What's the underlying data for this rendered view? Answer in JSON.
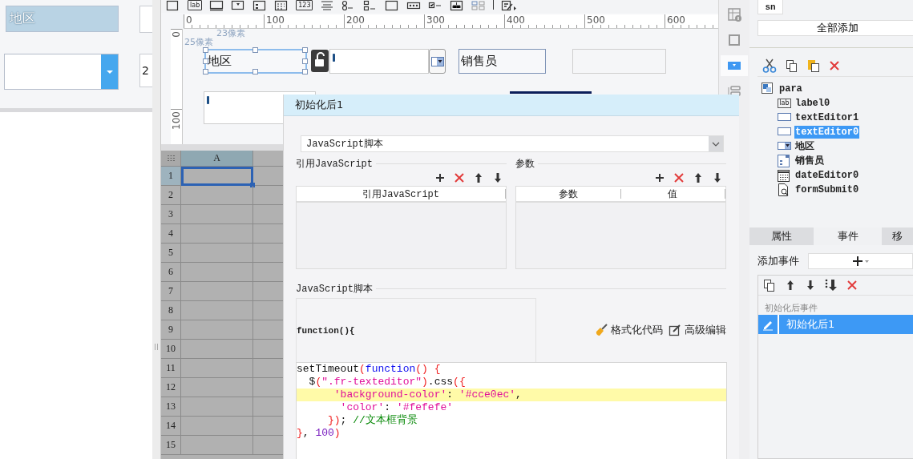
{
  "preview": {
    "label": "地区",
    "cut_text": "2"
  },
  "toolbar": [
    {
      "kind": "square"
    },
    {
      "kind": "text",
      "label": "lab"
    },
    {
      "kind": "textbox"
    },
    {
      "kind": "combo"
    },
    {
      "kind": "form"
    },
    {
      "kind": "grid"
    },
    {
      "kind": "text",
      "label": "123"
    },
    {
      "kind": "lines"
    },
    {
      "kind": "radio"
    },
    {
      "kind": "checklist"
    },
    {
      "kind": "textarea"
    },
    {
      "kind": "dots"
    },
    {
      "kind": "check"
    },
    {
      "kind": "tree"
    },
    {
      "kind": "tiles"
    },
    {
      "kind": "separator"
    },
    {
      "kind": "edit"
    }
  ],
  "ruler": {
    "h_labels": [
      "0",
      "100",
      "200",
      "300",
      "400",
      "500",
      "600"
    ],
    "v_labels": [
      "0",
      "100"
    ]
  },
  "canvas": {
    "hints": [
      "23像素",
      "25像素"
    ],
    "widgets": [
      {
        "kind": "label",
        "text": "地区",
        "selected": true
      },
      {
        "kind": "lock"
      },
      {
        "kind": "text"
      },
      {
        "kind": "combo_button"
      },
      {
        "kind": "label",
        "text": "销售员",
        "selected": false
      },
      {
        "kind": "empty"
      },
      {
        "kind": "text"
      },
      {
        "kind": "bar"
      }
    ]
  },
  "side_icons": [
    {
      "kind": "info",
      "selected": false
    },
    {
      "kind": "frame",
      "selected": false
    },
    {
      "kind": "combo",
      "selected": true
    },
    {
      "kind": "layout",
      "selected": false
    }
  ],
  "grid": {
    "columns": [
      "A"
    ],
    "rows": [
      {
        "label": "1",
        "selected": true
      },
      {
        "label": "2",
        "selected": false
      },
      {
        "label": "3",
        "selected": false
      },
      {
        "label": "4",
        "selected": false
      },
      {
        "label": "5",
        "selected": false
      },
      {
        "label": "6",
        "selected": false
      },
      {
        "label": "7",
        "selected": false
      },
      {
        "label": "8",
        "selected": false
      },
      {
        "label": "9",
        "selected": false
      },
      {
        "label": "10",
        "selected": false
      },
      {
        "label": "11",
        "selected": false
      },
      {
        "label": "12",
        "selected": false
      },
      {
        "label": "13",
        "selected": false
      },
      {
        "label": "14",
        "selected": false
      },
      {
        "label": "15",
        "selected": false
      }
    ]
  },
  "dialog": {
    "title": "初始化后1",
    "type": "JavaScript脚本",
    "ref_section": "引用JavaScript",
    "ref_columns": [
      "引用JavaScript"
    ],
    "param_section": "参数",
    "param_columns": [
      "参数",
      "值"
    ],
    "script_section": "JavaScript脚本",
    "signature": "function(){",
    "actions": [
      {
        "kind": "format",
        "label": "格式化代码"
      },
      {
        "kind": "advanced",
        "label": "高级编辑"
      }
    ],
    "code": [
      {
        "highlighted": false,
        "tokens": [
          {
            "kind": "plain",
            "text": "setTimeout"
          },
          {
            "kind": "punct",
            "text": "("
          },
          {
            "kind": "kw",
            "text": "function"
          },
          {
            "kind": "punct",
            "text": "() {"
          }
        ]
      },
      {
        "highlighted": false,
        "tokens": [
          {
            "kind": "plain",
            "text": "  $"
          },
          {
            "kind": "punct",
            "text": "("
          },
          {
            "kind": "str",
            "text": "\".fr-texteditor\""
          },
          {
            "kind": "punct",
            "text": ")"
          },
          {
            "kind": "plain",
            "text": ".css"
          },
          {
            "kind": "punct",
            "text": "({"
          }
        ]
      },
      {
        "highlighted": true,
        "tokens": [
          {
            "kind": "str",
            "text": "      'background-color'"
          },
          {
            "kind": "plain",
            "text": ": "
          },
          {
            "kind": "str",
            "text": "'#cce0ec'"
          },
          {
            "kind": "plain",
            "text": ","
          }
        ]
      },
      {
        "highlighted": false,
        "tokens": [
          {
            "kind": "str",
            "text": "       'color'"
          },
          {
            "kind": "plain",
            "text": ": "
          },
          {
            "kind": "str",
            "text": "'#fefefe'"
          }
        ]
      },
      {
        "highlighted": false,
        "tokens": [
          {
            "kind": "punct",
            "text": "     })"
          },
          {
            "kind": "plain",
            "text": "; "
          },
          {
            "kind": "comment",
            "text": "//文本框背景"
          }
        ]
      },
      {
        "highlighted": false,
        "tokens": [
          {
            "kind": "punct",
            "text": "}"
          },
          {
            "kind": "plain",
            "text": ", "
          },
          {
            "kind": "num",
            "text": "100"
          },
          {
            "kind": "punct",
            "text": ")"
          }
        ]
      }
    ]
  },
  "right": {
    "tab": "sn",
    "add_all": "全部添加",
    "tree": {
      "label": "para",
      "kind": "form",
      "selected": false,
      "children": [
        {
          "label": "label0",
          "kind": "label",
          "icon_text": "lab",
          "selected": false
        },
        {
          "label": "textEditor1",
          "kind": "text",
          "selected": false
        },
        {
          "label": "textEditor0",
          "kind": "text",
          "selected": true
        },
        {
          "label": "地区",
          "kind": "combo",
          "selected": false
        },
        {
          "label": "销售员",
          "kind": "list",
          "selected": false
        },
        {
          "label": "dateEditor0",
          "kind": "date",
          "selected": false
        },
        {
          "label": "formSubmit0",
          "kind": "submit",
          "selected": false
        }
      ]
    },
    "tabs": [
      {
        "label": "属性",
        "selected": false
      },
      {
        "label": "事件",
        "selected": true
      },
      {
        "label": "移",
        "selected": false
      }
    ],
    "add_event_label": "添加事件",
    "event_group": "初始化后事件",
    "events": [
      {
        "label": "初始化后1",
        "selected": true
      }
    ]
  }
}
